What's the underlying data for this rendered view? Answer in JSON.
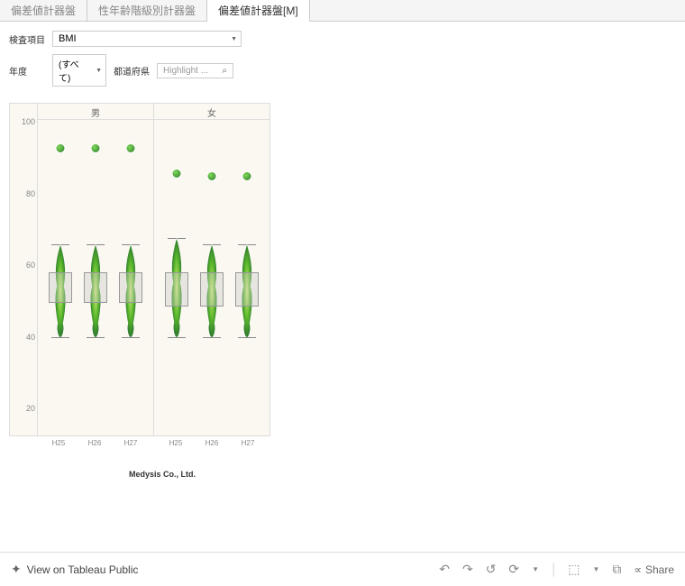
{
  "tabs": [
    {
      "label": "偏差値計器盤",
      "active": false
    },
    {
      "label": "性年齢階級別計器盤",
      "active": false
    },
    {
      "label": "偏差値計器盤[M]",
      "active": true
    }
  ],
  "controls": {
    "metric_label": "検査項目",
    "metric_value": "BMI",
    "year_label": "年度",
    "year_value": "(すべて)",
    "pref_label": "都道府県",
    "search_placeholder": "Highlight ..."
  },
  "chart_data": {
    "type": "box",
    "ylabel": "",
    "ylim": [
      0,
      100
    ],
    "yticks": [
      100.0,
      80.0,
      60.0,
      40.0,
      20.0
    ],
    "panels": [
      "男",
      "女"
    ],
    "categories": [
      "H25",
      "H26",
      "H27"
    ],
    "series": [
      {
        "panel": "男",
        "boxes": [
          {
            "cat": "H25",
            "whisker_low": 35,
            "q1": 46,
            "median": 50,
            "q3": 56,
            "whisker_high": 65,
            "outlier": 96
          },
          {
            "cat": "H26",
            "whisker_low": 35,
            "q1": 46,
            "median": 50,
            "q3": 56,
            "whisker_high": 65,
            "outlier": 96
          },
          {
            "cat": "H27",
            "whisker_low": 35,
            "q1": 46,
            "median": 50,
            "q3": 56,
            "whisker_high": 65,
            "outlier": 96
          }
        ]
      },
      {
        "panel": "女",
        "boxes": [
          {
            "cat": "H25",
            "whisker_low": 35,
            "q1": 45,
            "median": 49,
            "q3": 56,
            "whisker_high": 67,
            "outlier": 88
          },
          {
            "cat": "H26",
            "whisker_low": 35,
            "q1": 45,
            "median": 49,
            "q3": 56,
            "whisker_high": 65,
            "outlier": 87
          },
          {
            "cat": "H27",
            "whisker_low": 35,
            "q1": 45,
            "median": 49,
            "q3": 56,
            "whisker_high": 65,
            "outlier": 87
          }
        ]
      }
    ]
  },
  "attribution": "Medysis Co., Ltd.",
  "footer": {
    "view_label": "View on Tableau Public",
    "share_label": "Share"
  }
}
